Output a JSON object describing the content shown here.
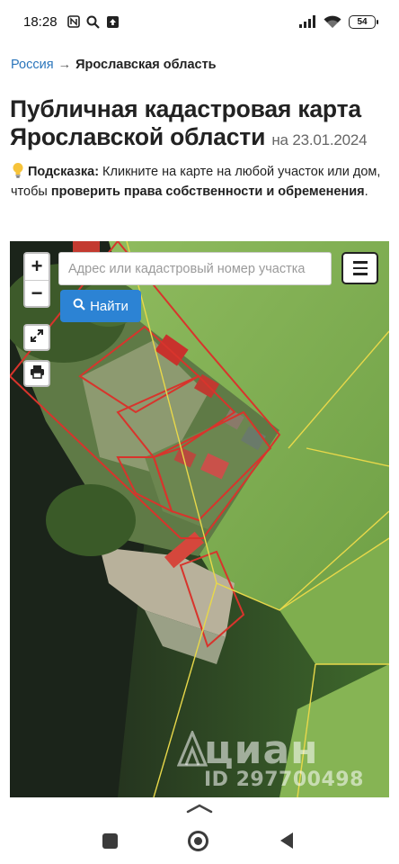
{
  "status_bar": {
    "time": "18:28",
    "battery": "54",
    "icons": [
      "nfc-icon",
      "search-icon",
      "upload-icon",
      "signal-icon",
      "wifi-icon",
      "battery-icon"
    ]
  },
  "breadcrumb": {
    "root": "Россия",
    "separator": "→",
    "current": "Ярославская область"
  },
  "title": {
    "main": "Публичная кадастровая карта Ярославской области",
    "date": "на 23.01.2024"
  },
  "hint": {
    "label": "Подсказка:",
    "text_before": " Кликните на карте на любой участок или дом, чтобы ",
    "bold_text": "проверить права собственности и обременения",
    "text_after": "."
  },
  "map": {
    "zoom_in": "+",
    "zoom_out": "−",
    "search_placeholder": "Адрес или кадастровый номер участка",
    "find_button": "Найти",
    "watermark_brand": "циан",
    "watermark_id": "ID 297700498",
    "colors": {
      "parcel_outline": "#d8342c",
      "boundary_line": "#e8d84a",
      "field": "#7fae4e",
      "water": "#1e2a1c",
      "find_button": "#2c83d4"
    }
  },
  "nav_bar": {
    "icons": [
      "recents-icon",
      "home-icon",
      "back-icon"
    ]
  }
}
